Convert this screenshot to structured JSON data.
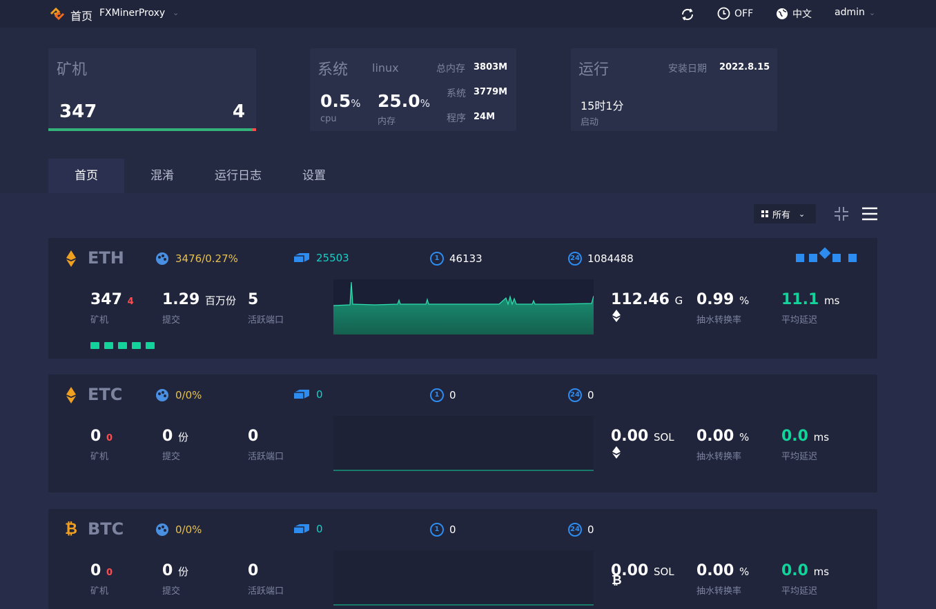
{
  "topbar": {
    "home": "首页",
    "app_name": "FXMinerProxy",
    "off_label": "OFF",
    "language": "中文",
    "user": "admin"
  },
  "stats": {
    "miners": {
      "title": "矿机",
      "online": "347",
      "offline": "4"
    },
    "system": {
      "title": "系统",
      "os": "linux",
      "total_mem_label": "总内存",
      "total_mem": "3803M",
      "sys_label": "系统",
      "sys_mem": "3779M",
      "prog_label": "程序",
      "prog_mem": "24M",
      "cpu_value": "0.5",
      "cpu_unit": "%",
      "cpu_label": "cpu",
      "mem_value": "25.0",
      "mem_unit": "%",
      "mem_label": "内存"
    },
    "run": {
      "title": "运行",
      "install_label": "安装日期",
      "install_date": "2022.8.15",
      "uptime": "15时1分",
      "uptime_label": "启动"
    }
  },
  "tabs": [
    "首页",
    "混淆",
    "运行日志",
    "设置"
  ],
  "filter": {
    "label": "所有"
  },
  "coins": [
    {
      "name": "ETH",
      "pool": "3476/0.27%",
      "shares": "25503",
      "c1": "46133",
      "c24": "1084488",
      "miners": "347",
      "miners_off": "4",
      "miners_label": "矿机",
      "submit": "1.29",
      "submit_unit": "百万份",
      "submit_label": "提交",
      "ports": "5",
      "ports_label": "活跃端口",
      "hashrate": "112.46",
      "hash_unit": "G",
      "rate": "0.99",
      "rate_unit": "%",
      "rate_label": "抽水转换率",
      "latency": "11.1",
      "latency_unit": "ms",
      "latency_label": "平均延迟"
    },
    {
      "name": "ETC",
      "pool": "0/0%",
      "shares": "0",
      "c1": "0",
      "c24": "0",
      "miners": "0",
      "miners_off": "0",
      "miners_label": "矿机",
      "submit": "0",
      "submit_unit": "份",
      "submit_label": "提交",
      "ports": "0",
      "ports_label": "活跃端口",
      "hashrate": "0.00",
      "hash_unit": "SOL",
      "rate": "0.00",
      "rate_unit": "%",
      "rate_label": "抽水转换率",
      "latency": "0.0",
      "latency_unit": "ms",
      "latency_label": "平均延迟"
    },
    {
      "name": "BTC",
      "pool": "0/0%",
      "shares": "0",
      "c1": "0",
      "c24": "0",
      "miners": "0",
      "miners_off": "0",
      "miners_label": "矿机",
      "submit": "0",
      "submit_unit": "份",
      "submit_label": "提交",
      "ports": "0",
      "ports_label": "活跃端口",
      "hashrate": "0.00",
      "hash_unit": "SOL",
      "rate": "0.00",
      "rate_unit": "%",
      "rate_label": "抽水转换率",
      "latency": "0.0",
      "latency_unit": "ms",
      "latency_label": "平均延迟"
    }
  ],
  "colors": {
    "accent": "#13d29a",
    "offline": "#ff4d4d",
    "pool": "#e8c14a",
    "shares": "#13d2c7",
    "icon_blue": "#2c8cf0"
  }
}
